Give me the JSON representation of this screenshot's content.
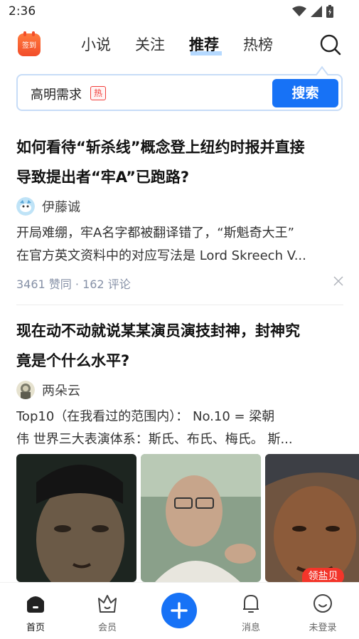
{
  "status_bar": {
    "time": "2:36"
  },
  "top_nav": {
    "checkin_label": "签到",
    "tabs": [
      {
        "label": "小说"
      },
      {
        "label": "关注"
      },
      {
        "label": "推荐"
      },
      {
        "label": "热榜"
      }
    ],
    "active_tab": "推荐"
  },
  "search": {
    "suggestion": "高明需求",
    "hot_badge": "热",
    "button_label": "搜索"
  },
  "feed": [
    {
      "title": "如何看待“斩杀线”概念登上纽约时报并直接导致提出者“牢A”已跑路?",
      "title_lines": [
        "如何看待“斩杀线”概念登上纽约时报并直接",
        "导致提出者“牢A”已跑路?"
      ],
      "author": "伊藤诚",
      "excerpt_lines": [
        "开局难绷，牢A名字都被翻译错了，“斯魁奇大王”",
        "在官方英文资料中的对应写法是 Lord Skreech V..."
      ],
      "meta": "3461 赞同 · 162 评论"
    },
    {
      "title": "现在动不动就说某某演员演技封神，封神究竟是个什么水平?",
      "title_lines": [
        "现在动不动就说某某演员演技封神，封神究",
        "竟是个什么水平?"
      ],
      "author": "两朵云",
      "excerpt_lines": [
        "Top10（在我看过的范围内）： No.10 = 梁朝",
        "伟  世界三大表演体系：斯氏、布氏、梅氏。 斯..."
      ]
    }
  ],
  "bottom_nav": {
    "items": [
      {
        "label": "首页"
      },
      {
        "label": "会员"
      },
      {
        "label": "消息"
      },
      {
        "label": "未登录"
      }
    ],
    "salt_badge": "领盐贝"
  },
  "colors": {
    "accent": "#1772f6",
    "hot": "#f1403c",
    "badge": "#f3352a"
  }
}
